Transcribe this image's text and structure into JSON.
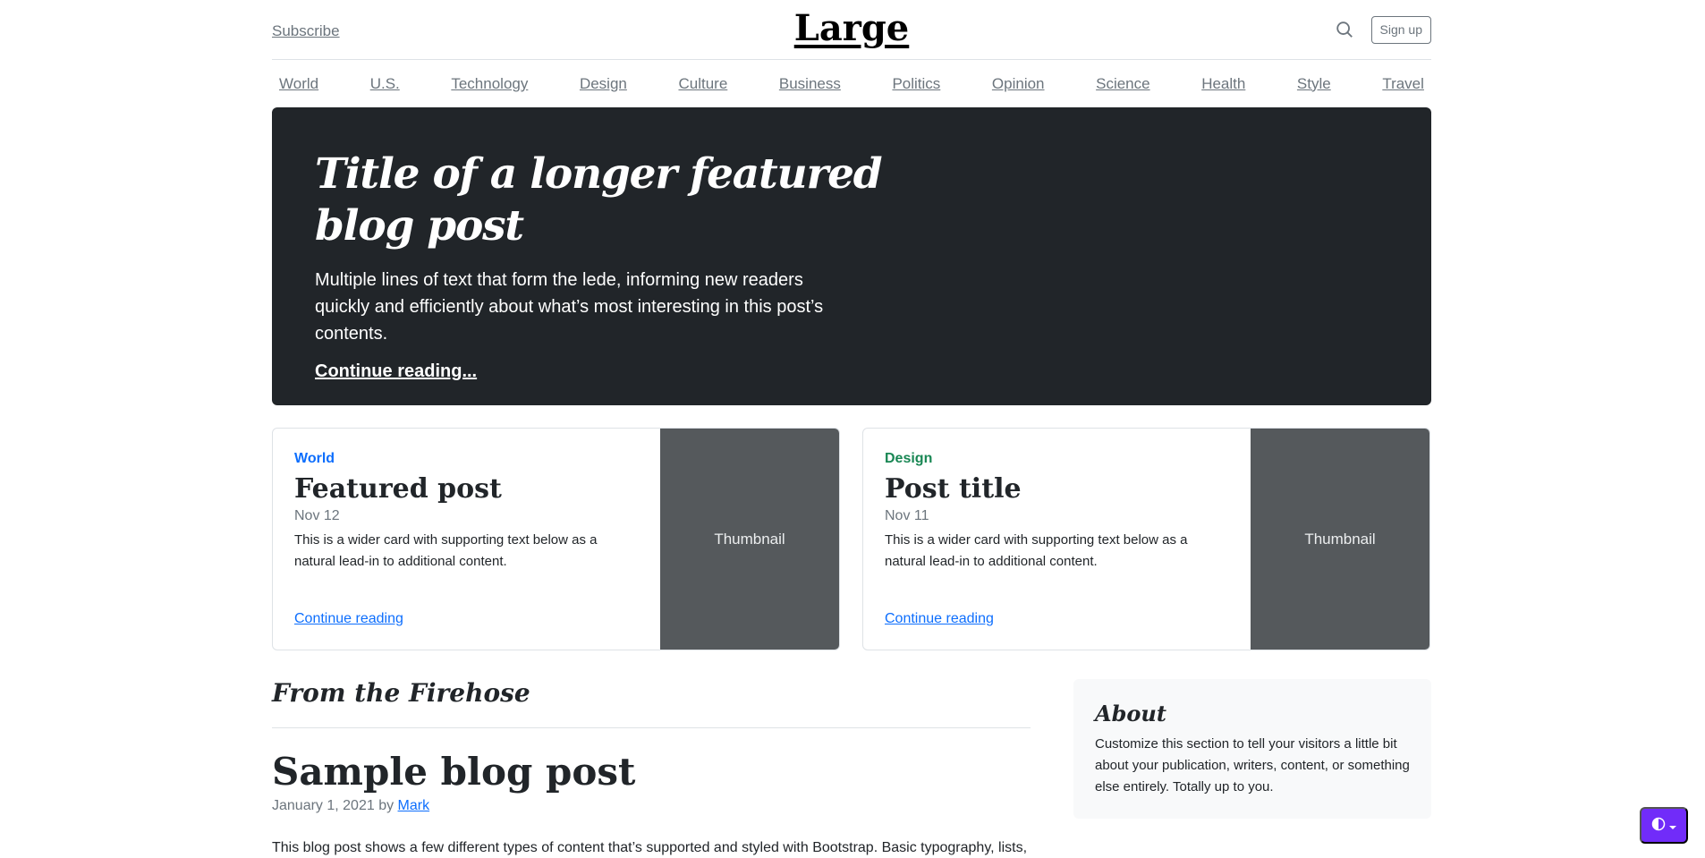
{
  "header": {
    "subscribe": "Subscribe",
    "brand": "Large",
    "search_icon": "search-icon",
    "signup": "Sign up"
  },
  "nav": {
    "items": [
      "World",
      "U.S.",
      "Technology",
      "Design",
      "Culture",
      "Business",
      "Politics",
      "Opinion",
      "Science",
      "Health",
      "Style",
      "Travel"
    ]
  },
  "hero": {
    "title": "Title of a longer featured blog post",
    "lede": "Multiple lines of text that form the lede, informing new readers quickly and efficiently about what’s most interesting in this post’s contents.",
    "link": "Continue reading..."
  },
  "cards": [
    {
      "category": "World",
      "category_color": "#0d6efd",
      "title": "Featured post",
      "date": "Nov 12",
      "text": "This is a wider card with supporting text below as a natural lead-in to additional content.",
      "link": "Continue reading",
      "thumb": "Thumbnail"
    },
    {
      "category": "Design",
      "category_color": "#198754",
      "title": "Post title",
      "date": "Nov 11",
      "text": "This is a wider card with supporting text below as a natural lead-in to additional content.",
      "link": "Continue reading",
      "thumb": "Thumbnail"
    }
  ],
  "firehose": {
    "heading": "From the Firehose",
    "post_title": "Sample blog post",
    "post_date": "January 1, 2021 by",
    "post_author": "Mark",
    "post_body": "This blog post shows a few different types of content that’s supported and styled with Bootstrap. Basic typography, lists,"
  },
  "about": {
    "title": "About",
    "text": "Customize this section to tell your visitors a little bit about your publication, writers, content, or something else entirely. Totally up to you."
  },
  "theme_toggle": {
    "icon": "contrast-icon",
    "accent": "#712cf9"
  }
}
